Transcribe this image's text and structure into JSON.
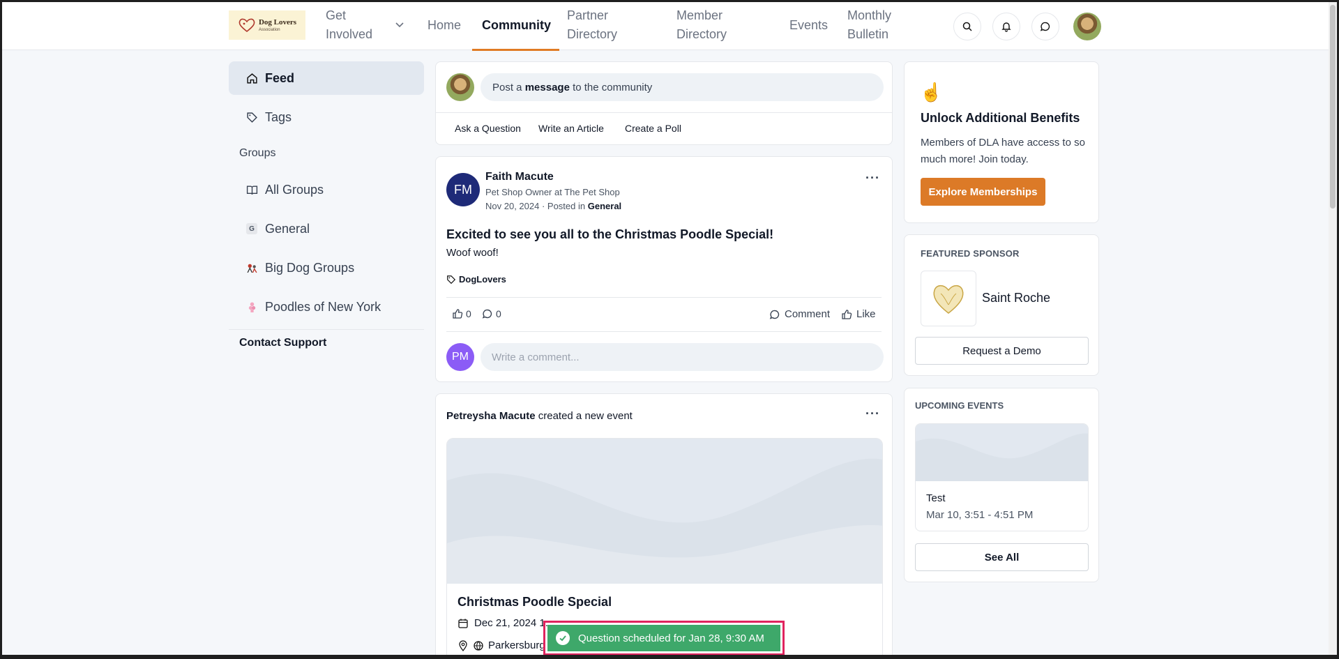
{
  "header": {
    "logo": {
      "name": "Dog Lovers",
      "sub": "Association"
    },
    "nav": [
      {
        "label": "Get Involved",
        "has_dropdown": true
      },
      {
        "label": "Home"
      },
      {
        "label": "Community",
        "active": true
      },
      {
        "label": "Partner Directory"
      },
      {
        "label": "Member Directory"
      },
      {
        "label": "Events"
      },
      {
        "label": "Monthly Bulletin"
      }
    ],
    "icons": [
      "search-icon",
      "bell-icon",
      "chat-icon",
      "user-avatar"
    ]
  },
  "sidebar": {
    "items": [
      {
        "label": "Feed",
        "icon": "home-icon",
        "active": true
      },
      {
        "label": "Tags",
        "icon": "tag-icon"
      }
    ],
    "groups_heading": "Groups",
    "groups": [
      {
        "label": "All Groups",
        "icon": "book-icon"
      },
      {
        "label": "General",
        "badge": "G"
      },
      {
        "label": "Big Dog Groups",
        "icon": "big-dog-icon"
      },
      {
        "label": "Poodles of New York",
        "icon": "poodle-icon"
      }
    ],
    "contact": "Contact Support"
  },
  "composer": {
    "prefix": "Post a ",
    "bold": "message",
    "suffix": " to the community",
    "actions": [
      "Ask a Question",
      "Write an Article",
      "Create a Poll"
    ]
  },
  "post": {
    "initials": "FM",
    "author": "Faith Macute",
    "role": "Pet Shop Owner at The Pet Shop",
    "date": "Nov 20, 2024",
    "posted_in_label": "· Posted in",
    "group": "General",
    "title": "Excited to see you all to the Christmas Poodle Special!",
    "body": "Woof woof!",
    "tag": "DogLovers",
    "likes": "0",
    "comments": "0",
    "comment_label": "Comment",
    "like_label": "Like",
    "commenter_initials": "PM",
    "comment_placeholder": "Write a comment..."
  },
  "event_post": {
    "creator": "Petreysha Macute",
    "action": "created a new event",
    "title": "Christmas Poodle Special",
    "date": "Dec 21, 2024 1:",
    "location": "Parkersburg"
  },
  "benefits": {
    "title": "Unlock Additional Benefits",
    "text": "Members of DLA have access to so much more! Join today.",
    "button": "Explore Memberships"
  },
  "sponsor": {
    "heading": "FEATURED SPONSOR",
    "name": "Saint Roche",
    "button": "Request a Demo"
  },
  "upcoming": {
    "heading": "UPCOMING EVENTS",
    "event_title": "Test",
    "event_time": "Mar 10, 3:51 - 4:51 PM",
    "button": "See All"
  },
  "toast": {
    "message": "Question scheduled for Jan 28, 9:30 AM"
  },
  "colors": {
    "accent": "#e07b24",
    "button": "#dc7a27",
    "toast": "#3ea86a",
    "highlight": "#e0245e"
  }
}
